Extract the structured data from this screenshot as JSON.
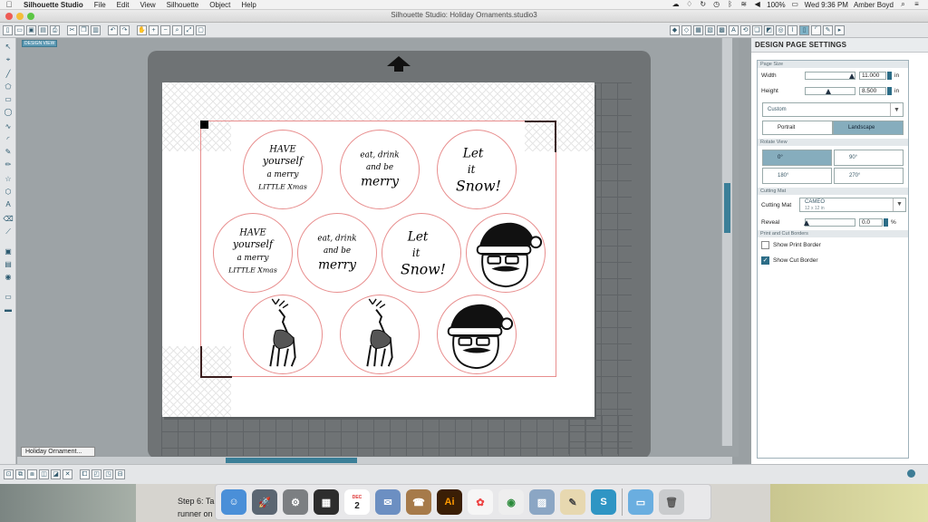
{
  "menubar": {
    "apple": "",
    "app_name": "Silhouette Studio",
    "menus": [
      "File",
      "Edit",
      "View",
      "Silhouette",
      "Object",
      "Help"
    ],
    "battery": "100%",
    "clock": "Wed 9:36 PM",
    "user": "Amber Boyd"
  },
  "window": {
    "title": "Silhouette Studio: Holiday Ornaments.studio3"
  },
  "design": {
    "view_tag": "DESIGN VIEW",
    "document_tab": "Holiday Ornament...",
    "ornaments": [
      {
        "text": "HAVE yourself a merry LITTLE Xmas"
      },
      {
        "text": "eat, drink and be merry"
      },
      {
        "text": "Let it Snow!"
      },
      {
        "text": "HAVE yourself a merry LITTLE Xmas"
      },
      {
        "text": "eat, drink and be merry"
      },
      {
        "text": "Let it Snow!"
      },
      {
        "text": "santa"
      },
      {
        "text": "reindeer"
      },
      {
        "text": "reindeer"
      },
      {
        "text": "santa"
      }
    ]
  },
  "panel": {
    "title": "DESIGN PAGE SETTINGS",
    "page_size_label": "Page Size",
    "width_label": "Width",
    "width_value": "11.000",
    "height_label": "Height",
    "height_value": "8.500",
    "unit": "in",
    "size_preset": "Custom",
    "portrait_label": "Portrait",
    "landscape_label": "Landscape",
    "rotate_label": "Rotate View",
    "rot_0": "0°",
    "rot_90": "90°",
    "rot_180": "180°",
    "rot_270": "270°",
    "cutting_mat_section": "Cutting Mat",
    "cutting_mat_label": "Cutting Mat",
    "cutting_mat_value": "CAMEO",
    "cutting_mat_sub": "12 x 12 in",
    "reveal_label": "Reveal",
    "reveal_value": "0.0",
    "reveal_unit": "%",
    "borders_label": "Print and Cut Borders",
    "show_print_border": "Show Print Border",
    "show_cut_border": "Show Cut Border"
  },
  "background": {
    "text_line1": "Step 6: Ta",
    "text_line2": "runner on"
  },
  "dock": {
    "calendar_day": "2",
    "calendar_month": "DEC",
    "illustrator": "Ai"
  }
}
